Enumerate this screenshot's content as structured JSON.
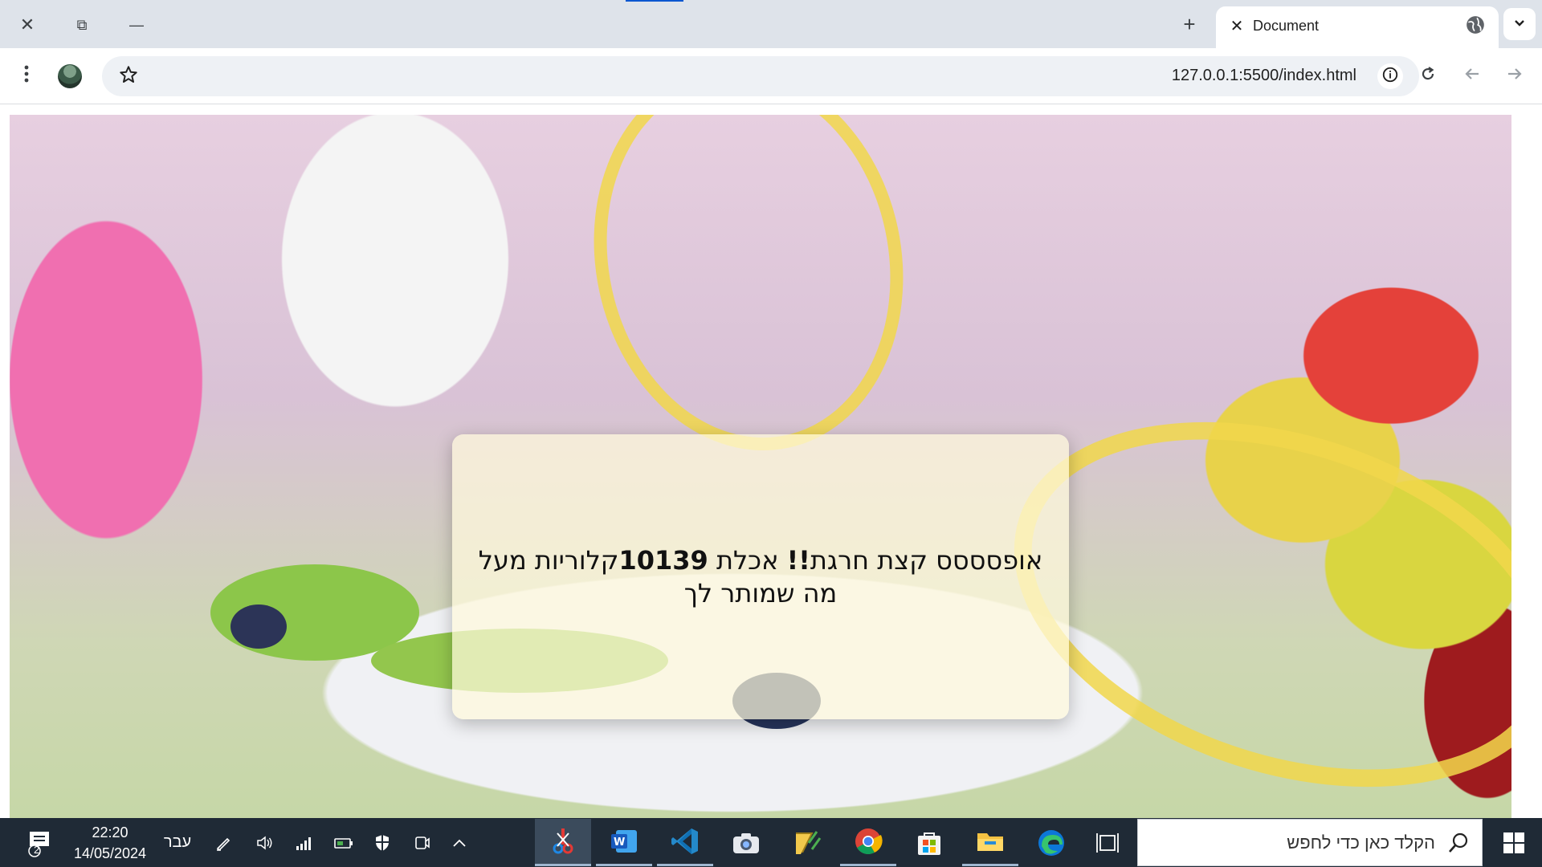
{
  "browser": {
    "window_controls": {
      "close": "✕",
      "restore": "⧉",
      "minimize": "—"
    },
    "new_tab": "+",
    "tab": {
      "close": "✕",
      "title": "Document",
      "favicon": "globe-icon"
    },
    "tab_search": "chevron-down-icon",
    "menu": "more-vert-icon",
    "profile": "avatar",
    "omnibox": {
      "url": "127.0.0.1:5500/index.html",
      "star": "star-icon",
      "info": "info-icon"
    },
    "nav": {
      "reload": "reload-icon",
      "back": "back-icon",
      "forward": "forward-icon"
    }
  },
  "page": {
    "message": {
      "part1": "אופסססס קצת חרגת",
      "emph1": "!!",
      "part2": " אכלת ",
      "number": "10139",
      "part3": "קלוריות מעל מה שמותר לך"
    }
  },
  "taskbar": {
    "notifications_count": "2",
    "time": "22:20",
    "date": "14/05/2024",
    "language": "עבר",
    "search_placeholder": "הקלד כאן כדי לחפש",
    "apps": [
      "snipping-tool",
      "word",
      "vscode",
      "camera",
      "winrar",
      "chrome",
      "store",
      "file-explorer",
      "edge",
      "task-view"
    ]
  },
  "colors": {
    "accent": "#0b57d0",
    "taskbar_bg": "#1f2a36",
    "tabstrip_bg": "#dee3ea"
  }
}
